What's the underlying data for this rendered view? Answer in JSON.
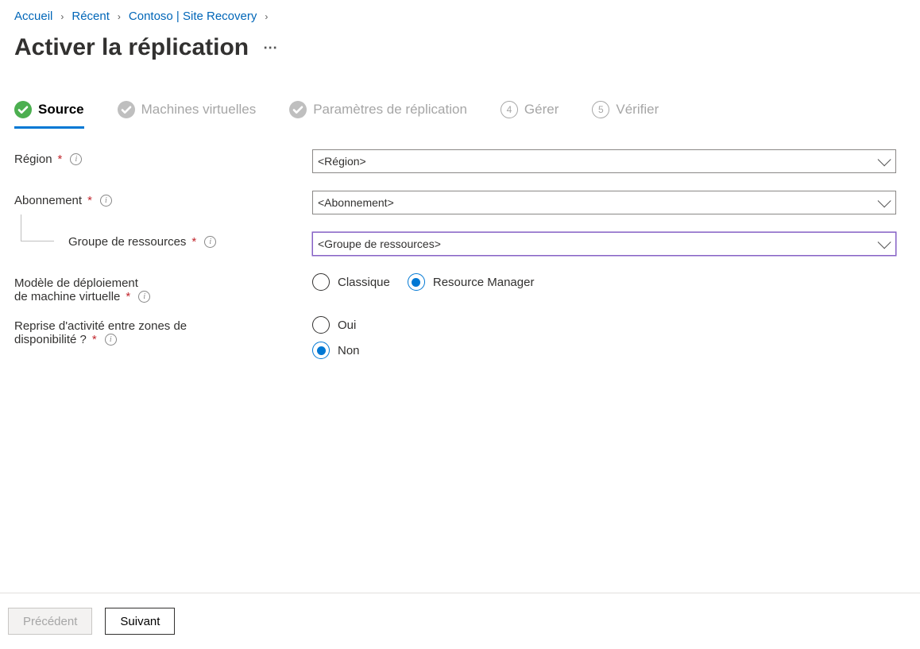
{
  "breadcrumb": {
    "items": [
      "Accueil",
      "Récent",
      "Contoso  | Site Recovery"
    ]
  },
  "page": {
    "title": "Activer la réplication"
  },
  "steps": {
    "s0": "Source",
    "s1": "Machines virtuelles",
    "s2": "Paramètres de réplication",
    "s3": "Gérer",
    "s3_num": "4",
    "s4": "Vérifier",
    "s4_num": "5"
  },
  "form": {
    "region": {
      "label": "Région",
      "value": "<Région>"
    },
    "subscription": {
      "label": "Abonnement",
      "value": "<Abonnement>"
    },
    "resource_group": {
      "label": "Groupe de ressources",
      "value": "<Groupe de ressources>"
    },
    "deployment_model": {
      "label_line1": "Modèle de déploiement",
      "label_line2": "de machine virtuelle",
      "option_classic": "Classique",
      "option_rm": "Resource Manager"
    },
    "zone_dr": {
      "label_line1": "Reprise d'activité entre zones de",
      "label_line2": "disponibilité ?",
      "option_yes": "Oui",
      "option_no": "Non"
    }
  },
  "footer": {
    "prev": "Précédent",
    "next": "Suivant"
  }
}
